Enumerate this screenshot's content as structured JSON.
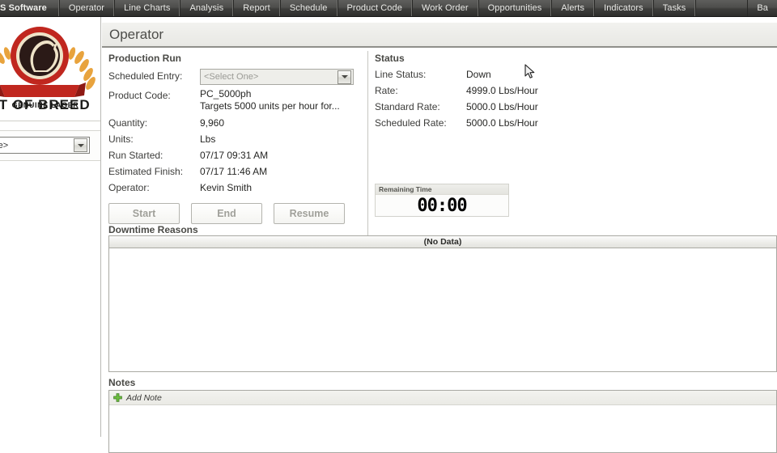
{
  "menubar": {
    "items": [
      {
        "label": "S Software",
        "name": "menu-brand"
      },
      {
        "label": "Operator",
        "name": "menu-operator"
      },
      {
        "label": "Line Charts",
        "name": "menu-line-charts"
      },
      {
        "label": "Analysis",
        "name": "menu-analysis"
      },
      {
        "label": "Report",
        "name": "menu-report"
      },
      {
        "label": "Schedule",
        "name": "menu-schedule"
      },
      {
        "label": "Product Code",
        "name": "menu-product-code"
      },
      {
        "label": "Work Order",
        "name": "menu-work-order"
      },
      {
        "label": "Opportunities",
        "name": "menu-opportunities"
      },
      {
        "label": "Alerts",
        "name": "menu-alerts"
      },
      {
        "label": "Indicators",
        "name": "menu-indicators"
      },
      {
        "label": "Tasks",
        "name": "menu-tasks"
      },
      {
        "label": "Ba",
        "name": "menu-truncated-right"
      }
    ]
  },
  "sidebar": {
    "logo": {
      "brand_line1": "ST OF BREED",
      "brand_line2": "GENUINE LAGER",
      "icon": "horse-head-emblem"
    },
    "line_select": {
      "value": "One>",
      "icon": "chevron-down-icon"
    }
  },
  "header": {
    "title": "Operator"
  },
  "production_run": {
    "title": "Production Run",
    "scheduled_entry": {
      "label": "Scheduled Entry:",
      "value": "<Select One>",
      "icon": "chevron-down-icon"
    },
    "product_code": {
      "label": "Product Code:",
      "value": "PC_5000ph",
      "description": "Targets 5000 units per hour for..."
    },
    "quantity": {
      "label": "Quantity:",
      "value": "9,960"
    },
    "units": {
      "label": "Units:",
      "value": "Lbs"
    },
    "run_started": {
      "label": "Run Started:",
      "value": "07/17 09:31 AM"
    },
    "estimated_finish": {
      "label": "Estimated Finish:",
      "value": "07/17 11:46 AM"
    },
    "operator": {
      "label": "Operator:",
      "value": "Kevin Smith"
    },
    "buttons": {
      "start": "Start",
      "end": "End",
      "resume": "Resume"
    }
  },
  "status": {
    "title": "Status",
    "line_status": {
      "label": "Line Status:",
      "value": "Down"
    },
    "rate": {
      "label": "Rate:",
      "value": "4999.0 Lbs/Hour"
    },
    "standard_rate": {
      "label": "Standard Rate:",
      "value": "5000.0 Lbs/Hour"
    },
    "scheduled_rate": {
      "label": "Scheduled Rate:",
      "value": "5000.0 Lbs/Hour"
    },
    "remaining_time": {
      "caption": "Remaining Time",
      "value": "00:00"
    }
  },
  "downtime_reasons": {
    "title": "Downtime Reasons",
    "header": "(No Data)",
    "rows": []
  },
  "notes": {
    "title": "Notes",
    "add_note_label": "Add Note",
    "add_note_icon": "green-plus-icon",
    "rows": []
  },
  "colors": {
    "menubar_bg": "#3d3d3b",
    "accent_red": "#c0392b",
    "status_down": "#262624",
    "plus_green": "#6cbf3f"
  }
}
